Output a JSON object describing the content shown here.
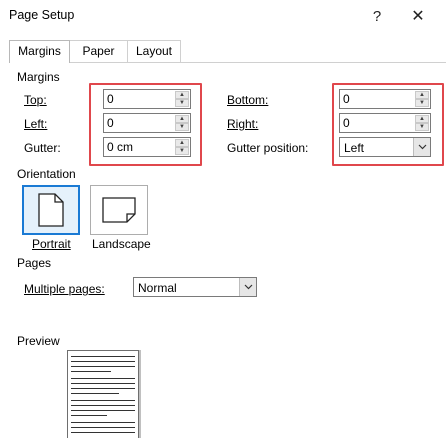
{
  "window": {
    "title": "Page Setup",
    "help_glyph": "?",
    "close_glyph": "✕"
  },
  "tabs": [
    {
      "label": "Margins",
      "active": true
    },
    {
      "label": "Paper",
      "active": false
    },
    {
      "label": "Layout",
      "active": false
    }
  ],
  "margins": {
    "section_label": "Margins",
    "top": {
      "label": "Top:",
      "value": "0"
    },
    "left": {
      "label": "Left:",
      "value": "0"
    },
    "gutter": {
      "label": "Gutter:",
      "value": "0 cm"
    },
    "bottom": {
      "label": "Bottom:",
      "value": "0"
    },
    "right": {
      "label": "Right:",
      "value": "0"
    },
    "gutter_position": {
      "label": "Gutter position:",
      "value": "Left"
    }
  },
  "orientation": {
    "section_label": "Orientation",
    "portrait_label": "Portrait",
    "landscape_label": "Landscape",
    "selected": "Portrait"
  },
  "pages": {
    "section_label": "Pages",
    "multiple_pages_label": "Multiple pages:",
    "multiple_pages_value": "Normal"
  },
  "preview": {
    "section_label": "Preview"
  },
  "colors": {
    "highlight": "#e0474c",
    "selection_border": "#1a7ad4",
    "selection_fill": "#e5f1fb"
  }
}
